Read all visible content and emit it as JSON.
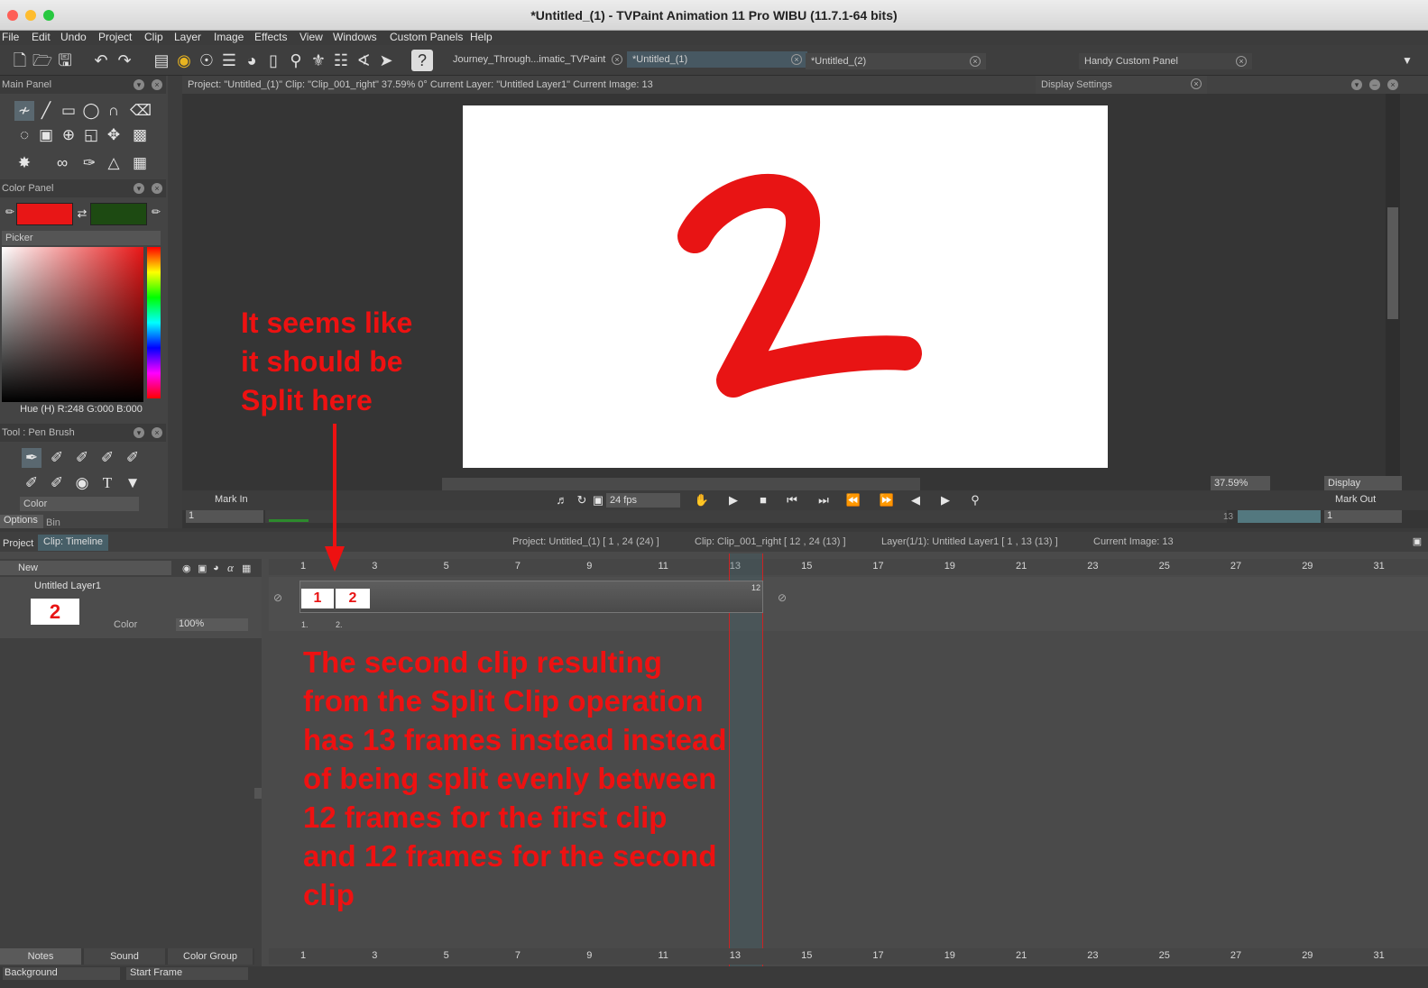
{
  "window": {
    "title": "*Untitled_(1) - TVPaint Animation 11 Pro WIBU (11.7.1-64 bits)"
  },
  "menu": [
    "File",
    "Edit",
    "Undo",
    "Project",
    "Clip",
    "Layer",
    "Image",
    "Effects",
    "View",
    "Windows",
    "Custom Panels",
    "Help"
  ],
  "doc_tabs": [
    {
      "label": "Journey_Through...imatic_TVPaint"
    },
    {
      "label": "*Untitled_(1)"
    },
    {
      "label": "*Untitled_(2)"
    }
  ],
  "handy_panel": {
    "label": "Handy Custom Panel"
  },
  "main_panel": {
    "label": "Main Panel"
  },
  "color_panel": {
    "label": "Color Panel",
    "primary_color": "#e81616",
    "secondary_color": "#1d4a12",
    "picker_label": "Picker",
    "readout": "Hue (H) R:248 G:000 B:000"
  },
  "tool_panel": {
    "label": "Tool : Pen Brush",
    "color_select": "Color",
    "tabs": [
      "Options",
      "Bin"
    ]
  },
  "project_status": "Project: \"Untitled_(1)\" Clip: \"Clip_001_right\"   37.59%   0°   Current Layer: \"Untitled Layer1\"   Current Image: 13",
  "display_settings": {
    "label": "Display Settings"
  },
  "canvas": {
    "drawn_digit": "2",
    "stroke_color": "#e81414"
  },
  "view_controls": {
    "zoom": "37.59%",
    "display_label": "Display"
  },
  "transport": {
    "mark_in": "Mark In",
    "mark_out": "Mark Out",
    "fps": "24 fps",
    "in_value": "1",
    "out_value": "1",
    "current": "13"
  },
  "timeline_header": {
    "tabs": [
      "Project",
      "Clip: Timeline"
    ],
    "project_info": "Project: Untitled_(1) [ 1 , 24  (24) ]",
    "clip_info": "Clip: Clip_001_right [ 12 , 24  (13) ]",
    "layer_info": "Layer(1/1): Untitled Layer1 [ 1 , 13  (13) ]",
    "image_info": "Current Image: 13"
  },
  "layer": {
    "new_label": "New",
    "name": "Untitled Layer1",
    "blend": "Color",
    "opacity": "100%",
    "thumb_digit": "2"
  },
  "ruler": [
    "1",
    "3",
    "5",
    "7",
    "9",
    "11",
    "13",
    "15",
    "17",
    "19",
    "21",
    "23",
    "25",
    "27",
    "29",
    "31"
  ],
  "clips": [
    {
      "digit": "1",
      "label": "1."
    },
    {
      "digit": "2",
      "label": "2."
    }
  ],
  "clip_end_frame": "12",
  "bottom_tabs": [
    "Notes",
    "Sound",
    "Color Group"
  ],
  "bottom_bar": {
    "background": "Background",
    "start_frame": "Start Frame"
  },
  "annotations": {
    "top": [
      "It seems like",
      "it should be",
      "Split here"
    ],
    "bottom": [
      "The second clip resulting",
      "from the Split Clip operation",
      "has 13 frames instead instead",
      "of being split evenly between",
      "12 frames for the first clip",
      "and 12 frames for the second",
      "clip"
    ]
  }
}
